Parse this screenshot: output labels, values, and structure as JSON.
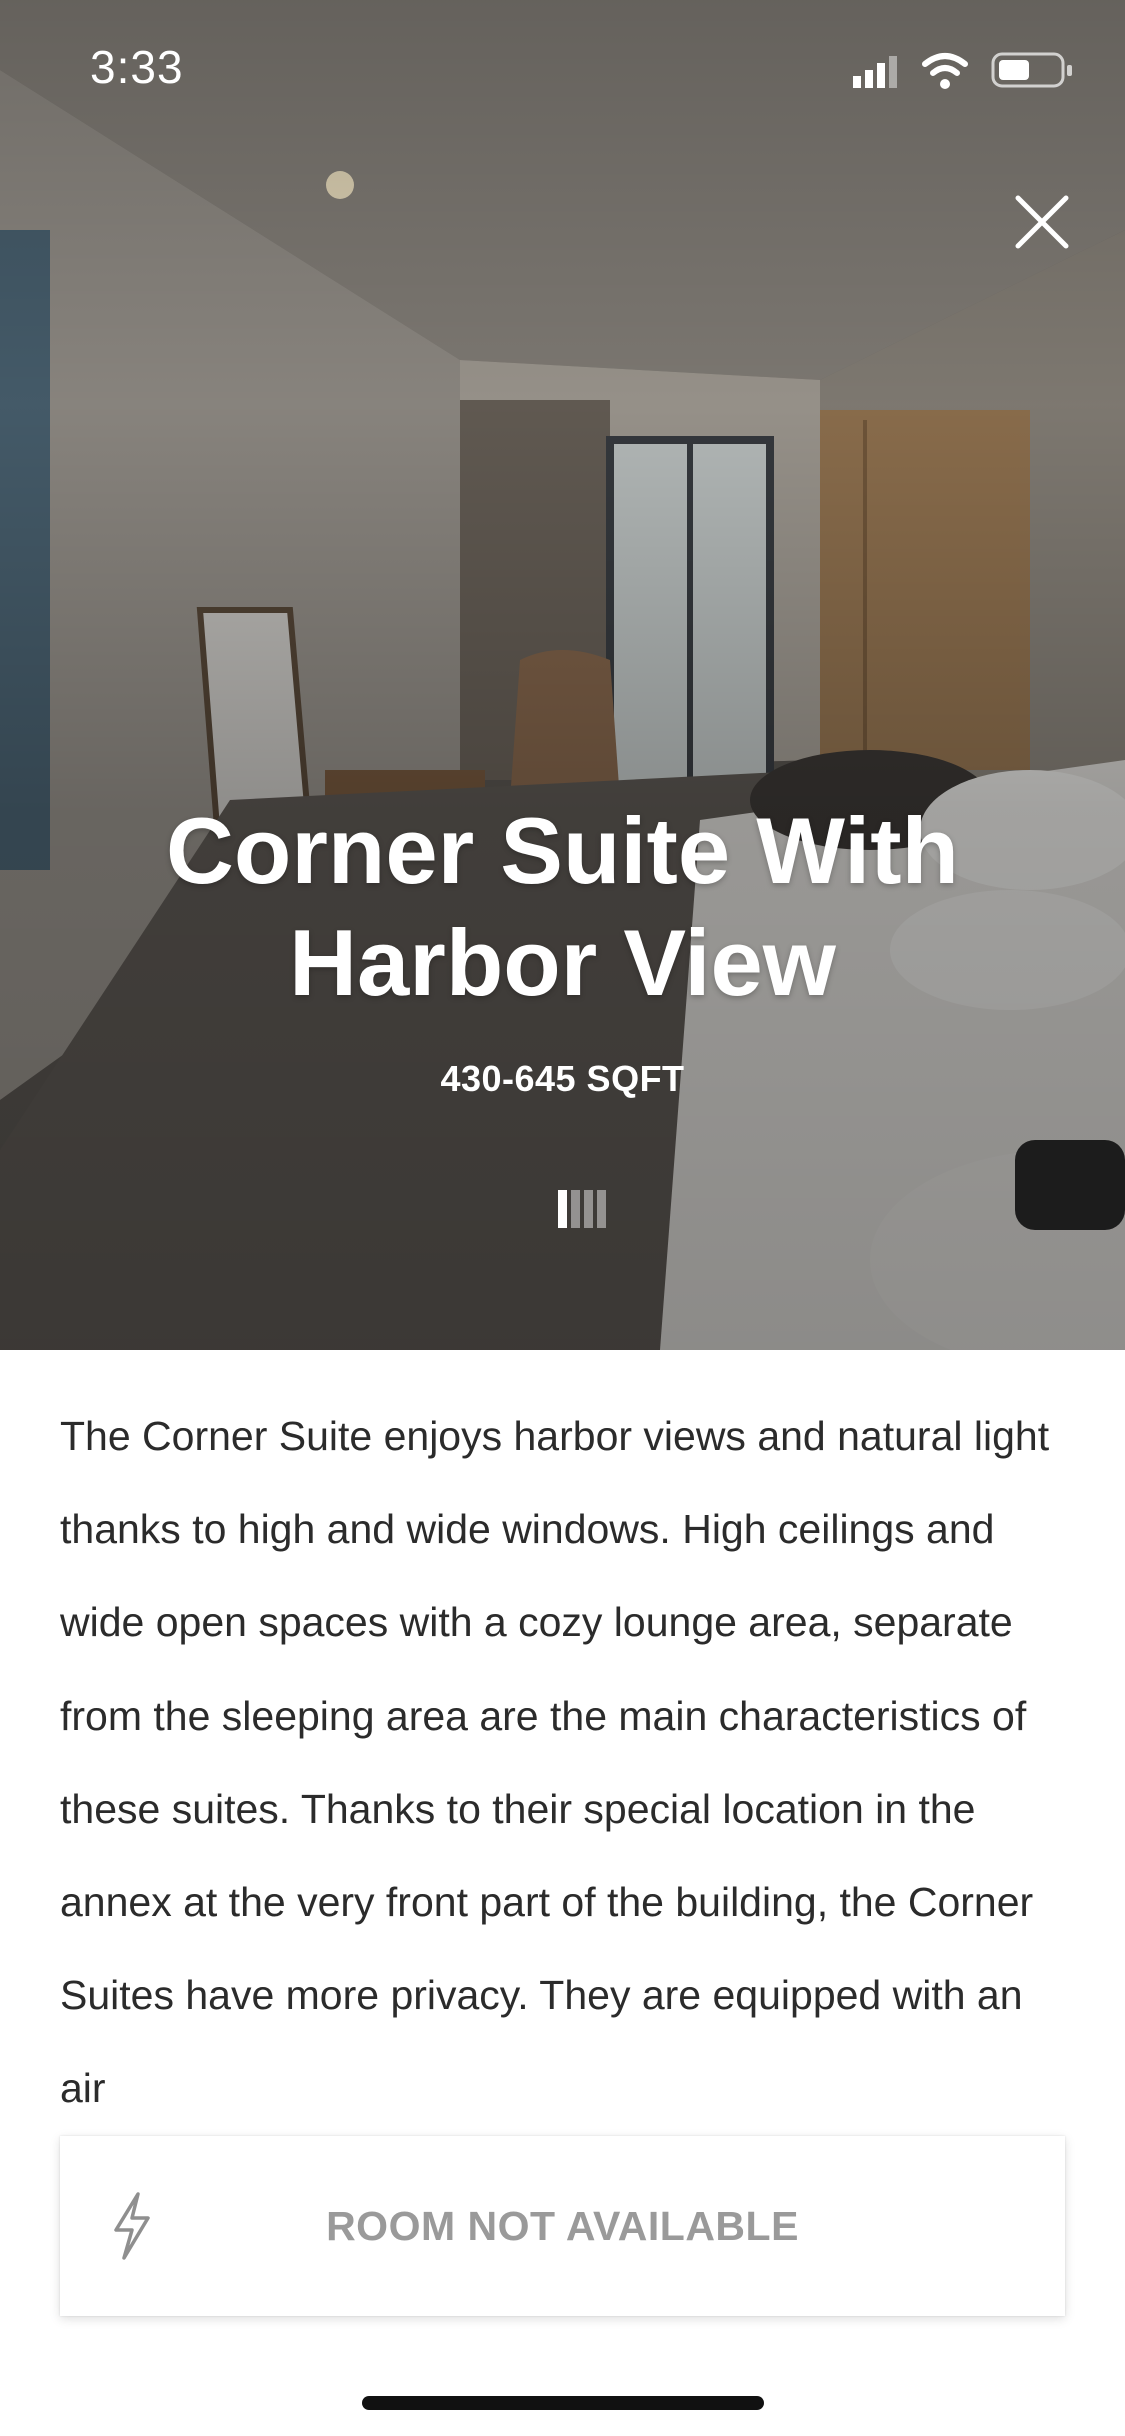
{
  "status_bar": {
    "time": "3:33"
  },
  "hero": {
    "title": "Corner Suite With Harbor View",
    "size": "430-645 SQFT",
    "photo_icon": "bedroom-photo",
    "pager": {
      "total": 4,
      "active_index": 0
    }
  },
  "description": {
    "text": "The Corner Suite enjoys harbor views and natural light thanks to high and wide windows. High ceilings and wide open spaces with a cozy lounge area, separate from the sleeping area are the main characteristics of these suites. Thanks to their special location in the annex at the very front part of the building, the Corner Suites have more privacy. They are equipped with an air"
  },
  "availability": {
    "label": "ROOM NOT AVAILABLE",
    "icon": "lightning-icon"
  },
  "colors": {
    "text": "#2b2b2b",
    "muted": "#9a9a9a",
    "white": "#ffffff"
  }
}
